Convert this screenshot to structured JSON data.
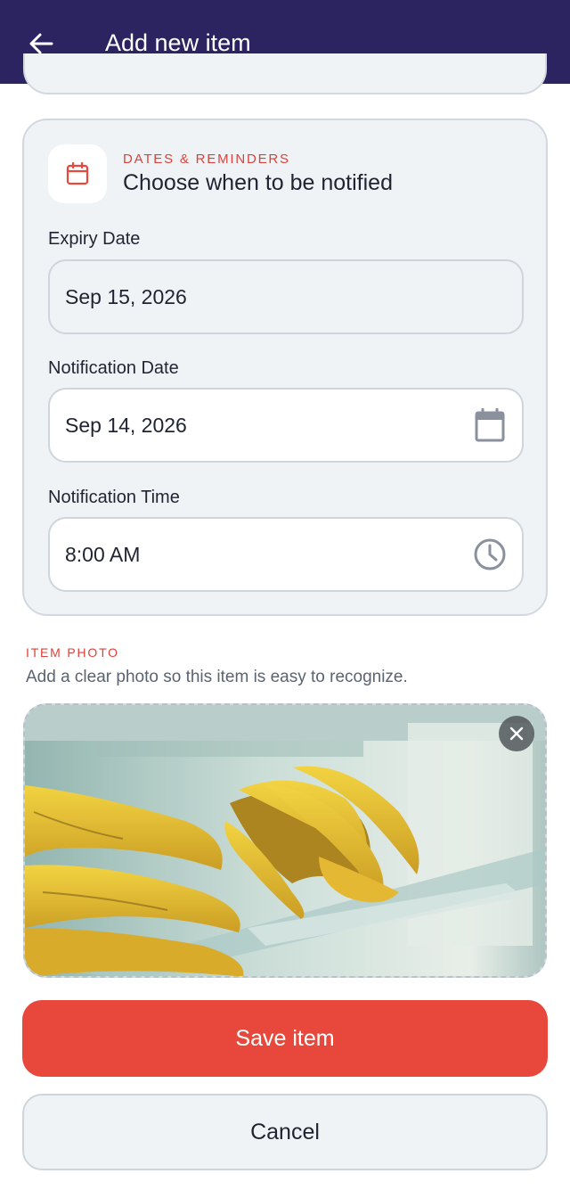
{
  "app_bar": {
    "title": "Add new item",
    "back_icon": "arrow-left-icon",
    "background": "#2c2461"
  },
  "reminders": {
    "kicker": "DATES & REMINDERS",
    "heading": "Choose when to be notified",
    "icon": "calendar-icon",
    "expiry": {
      "label": "Expiry Date",
      "value": "Sep 15, 2026"
    },
    "notification_date": {
      "label": "Notification Date",
      "value": "Sep 14, 2026",
      "icon": "calendar-icon"
    },
    "notification_time": {
      "label": "Notification Time",
      "value": "8:00 AM",
      "icon": "clock-icon"
    }
  },
  "photo": {
    "kicker": "ITEM PHOTO",
    "hint": "Add a clear photo so this item is easy to recognize.",
    "subject": "bananas on a refrigerator shelf",
    "remove_icon": "close-icon"
  },
  "actions": {
    "save_label": "Save item",
    "cancel_label": "Cancel"
  },
  "colors": {
    "accent": "#e8483b",
    "kicker": "#d9433a",
    "card_bg": "#f0f3f6"
  }
}
